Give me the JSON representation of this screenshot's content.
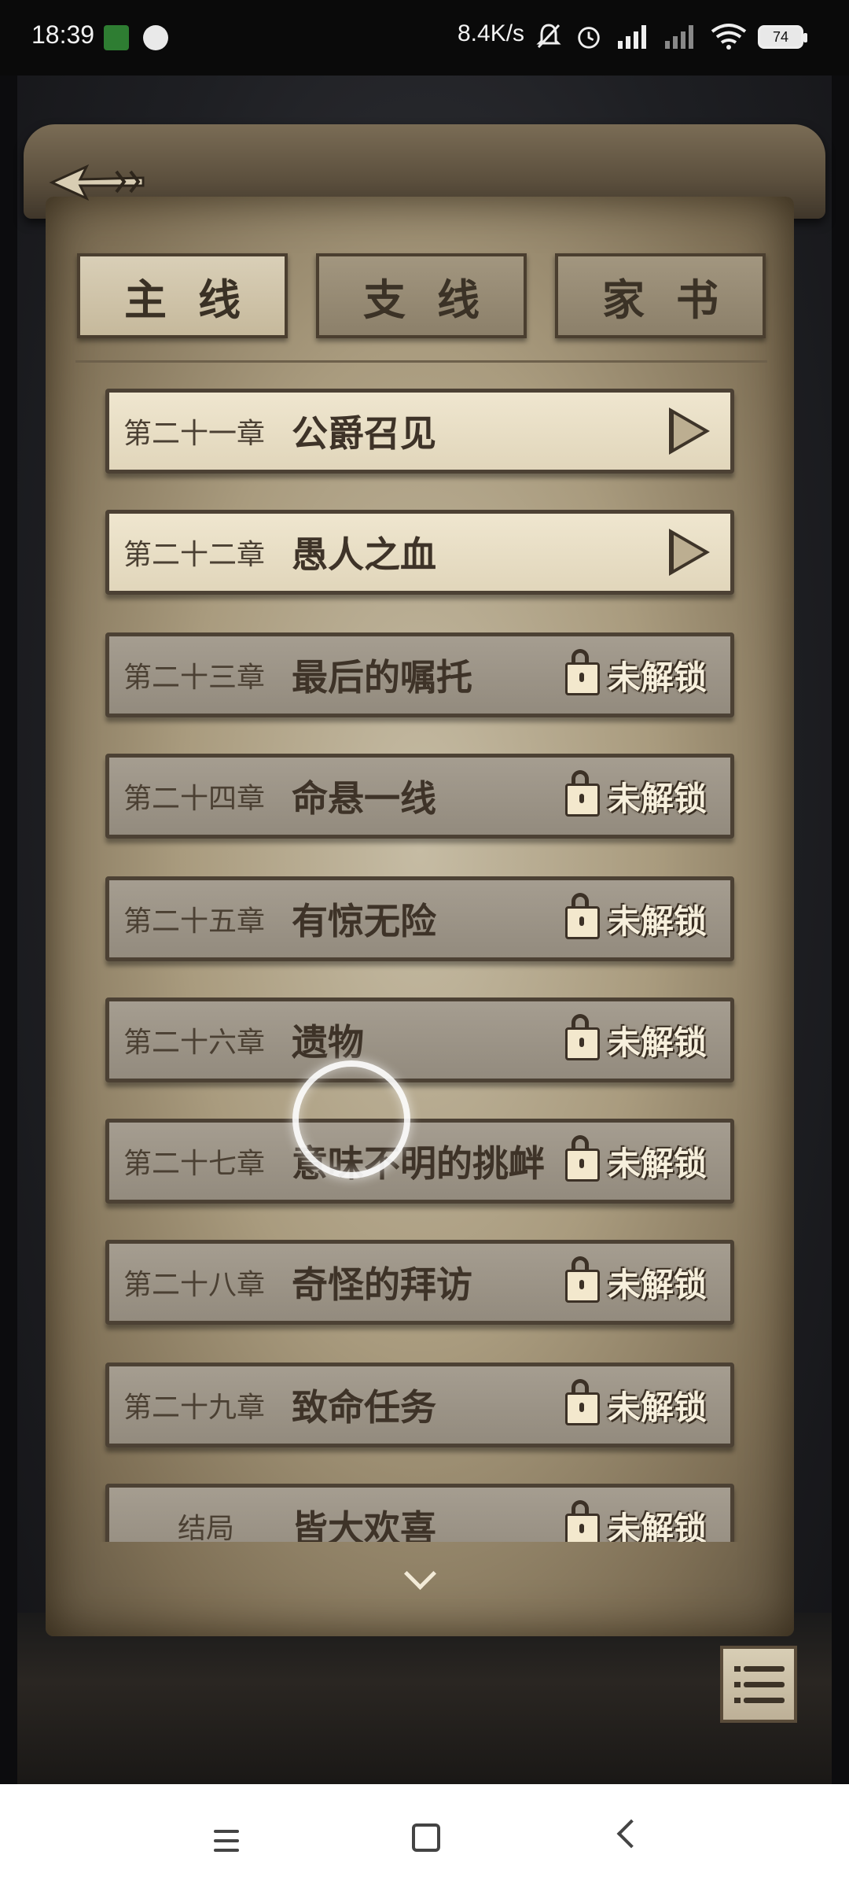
{
  "status_bar": {
    "time": "18:39",
    "net_speed": "8.4K/s",
    "battery": "74"
  },
  "tabs": [
    {
      "label": "主线",
      "active": true
    },
    {
      "label": "支线",
      "active": false
    },
    {
      "label": "家书",
      "active": false
    }
  ],
  "chapters": [
    {
      "number": "第二十一章",
      "title": "公爵召见",
      "state": "unlocked"
    },
    {
      "number": "第二十二章",
      "title": "愚人之血",
      "state": "unlocked"
    },
    {
      "number": "第二十三章",
      "title": "最后的嘱托",
      "state": "locked"
    },
    {
      "number": "第二十四章",
      "title": "命悬一线",
      "state": "locked"
    },
    {
      "number": "第二十五章",
      "title": "有惊无险",
      "state": "locked"
    },
    {
      "number": "第二十六章",
      "title": "遗物",
      "state": "locked"
    },
    {
      "number": "第二十七章",
      "title": "意味不明的挑衅",
      "state": "locked"
    },
    {
      "number": "第二十八章",
      "title": "奇怪的拜访",
      "state": "locked"
    },
    {
      "number": "第二十九章",
      "title": "致命任务",
      "state": "locked"
    },
    {
      "number": "结局",
      "title": "皆大欢喜",
      "state": "locked"
    }
  ],
  "locked_label": "未解锁",
  "icons": {
    "back": "arrow-back-icon",
    "play": "play-icon",
    "lock": "lock-icon",
    "scroll_down": "chevron-down-icon",
    "list": "list-icon"
  },
  "colors": {
    "parchment": "#a99b7e",
    "unlocked_row": "#e9dfc5",
    "locked_row": "#9d9588",
    "text_dark": "#3e3328"
  }
}
